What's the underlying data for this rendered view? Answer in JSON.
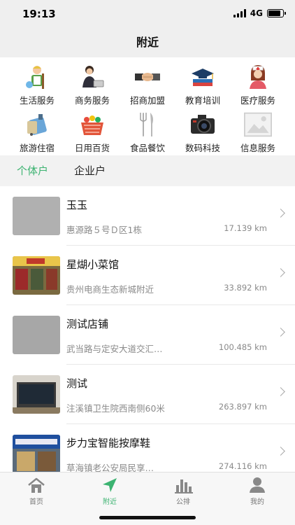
{
  "status": {
    "time": "19:13",
    "network": "4G"
  },
  "header": {
    "title": "附近"
  },
  "categories": [
    {
      "label": "生活服务",
      "icon": "cleaner-icon"
    },
    {
      "label": "商务服务",
      "icon": "business-person-icon"
    },
    {
      "label": "招商加盟",
      "icon": "handshake-icon"
    },
    {
      "label": "教育培训",
      "icon": "graduation-cap-icon"
    },
    {
      "label": "医疗服务",
      "icon": "nurse-icon"
    },
    {
      "label": "旅游住宿",
      "icon": "luggage-icon"
    },
    {
      "label": "日用百货",
      "icon": "shopping-basket-icon"
    },
    {
      "label": "食品餐饮",
      "icon": "cutlery-icon"
    },
    {
      "label": "数码科技",
      "icon": "camera-icon"
    },
    {
      "label": "信息服务",
      "icon": "image-placeholder-icon"
    }
  ],
  "tabs": {
    "active": "个体户",
    "inactive": "企业户"
  },
  "shops": [
    {
      "name": "玉玉",
      "address": "惠源路５号Ｄ区1栋",
      "distance": "17.139 km"
    },
    {
      "name": "星煳小菜馆",
      "address": "贵州电商生态新城附近",
      "distance": "33.892 km"
    },
    {
      "name": "测试店铺",
      "address": "武当路与定安大道交汇…",
      "distance": "100.485 km"
    },
    {
      "name": "测试",
      "address": "注溪镇卫生院西南侧60米",
      "distance": "263.897 km"
    },
    {
      "name": "步力宝智能按摩鞋",
      "address": "草海镇老公安局民享…",
      "distance": "274.116 km"
    }
  ],
  "tabbar": [
    {
      "label": "首页",
      "icon": "home-icon"
    },
    {
      "label": "附近",
      "icon": "location-arrow-icon"
    },
    {
      "label": "公排",
      "icon": "bar-chart-icon"
    },
    {
      "label": "我的",
      "icon": "user-icon"
    }
  ],
  "colors": {
    "accent": "#3cb371"
  }
}
